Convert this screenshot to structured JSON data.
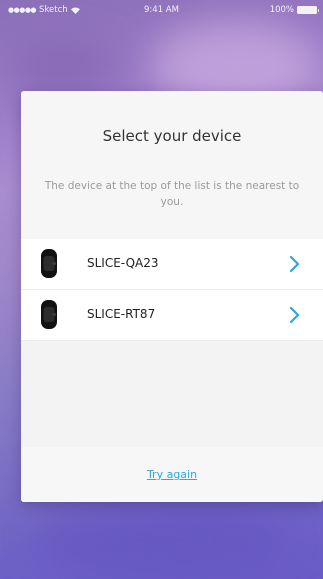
{
  "status_bar": {
    "carrier": "Sketch",
    "signal_dots": "●●●●●",
    "time": "9:41 AM",
    "battery": "100%"
  },
  "modal": {
    "title": "Select your device",
    "description": "The device at the top of the list is the nearest to you.",
    "devices": [
      {
        "name": "SLICE-QA23",
        "icon": "fitness-band-icon",
        "action_icon": "chevron-right-icon"
      },
      {
        "name": "SLICE-RT87",
        "icon": "fitness-band-icon",
        "action_icon": "chevron-right-icon"
      }
    ],
    "footer_link": "Try again"
  },
  "colors": {
    "accent": "#2ea7dc",
    "background_gradient_top": "#8b6fb8",
    "background_gradient_bottom": "#6a5bc7",
    "title_text": "#333333",
    "muted_text": "#9a9a9a"
  }
}
